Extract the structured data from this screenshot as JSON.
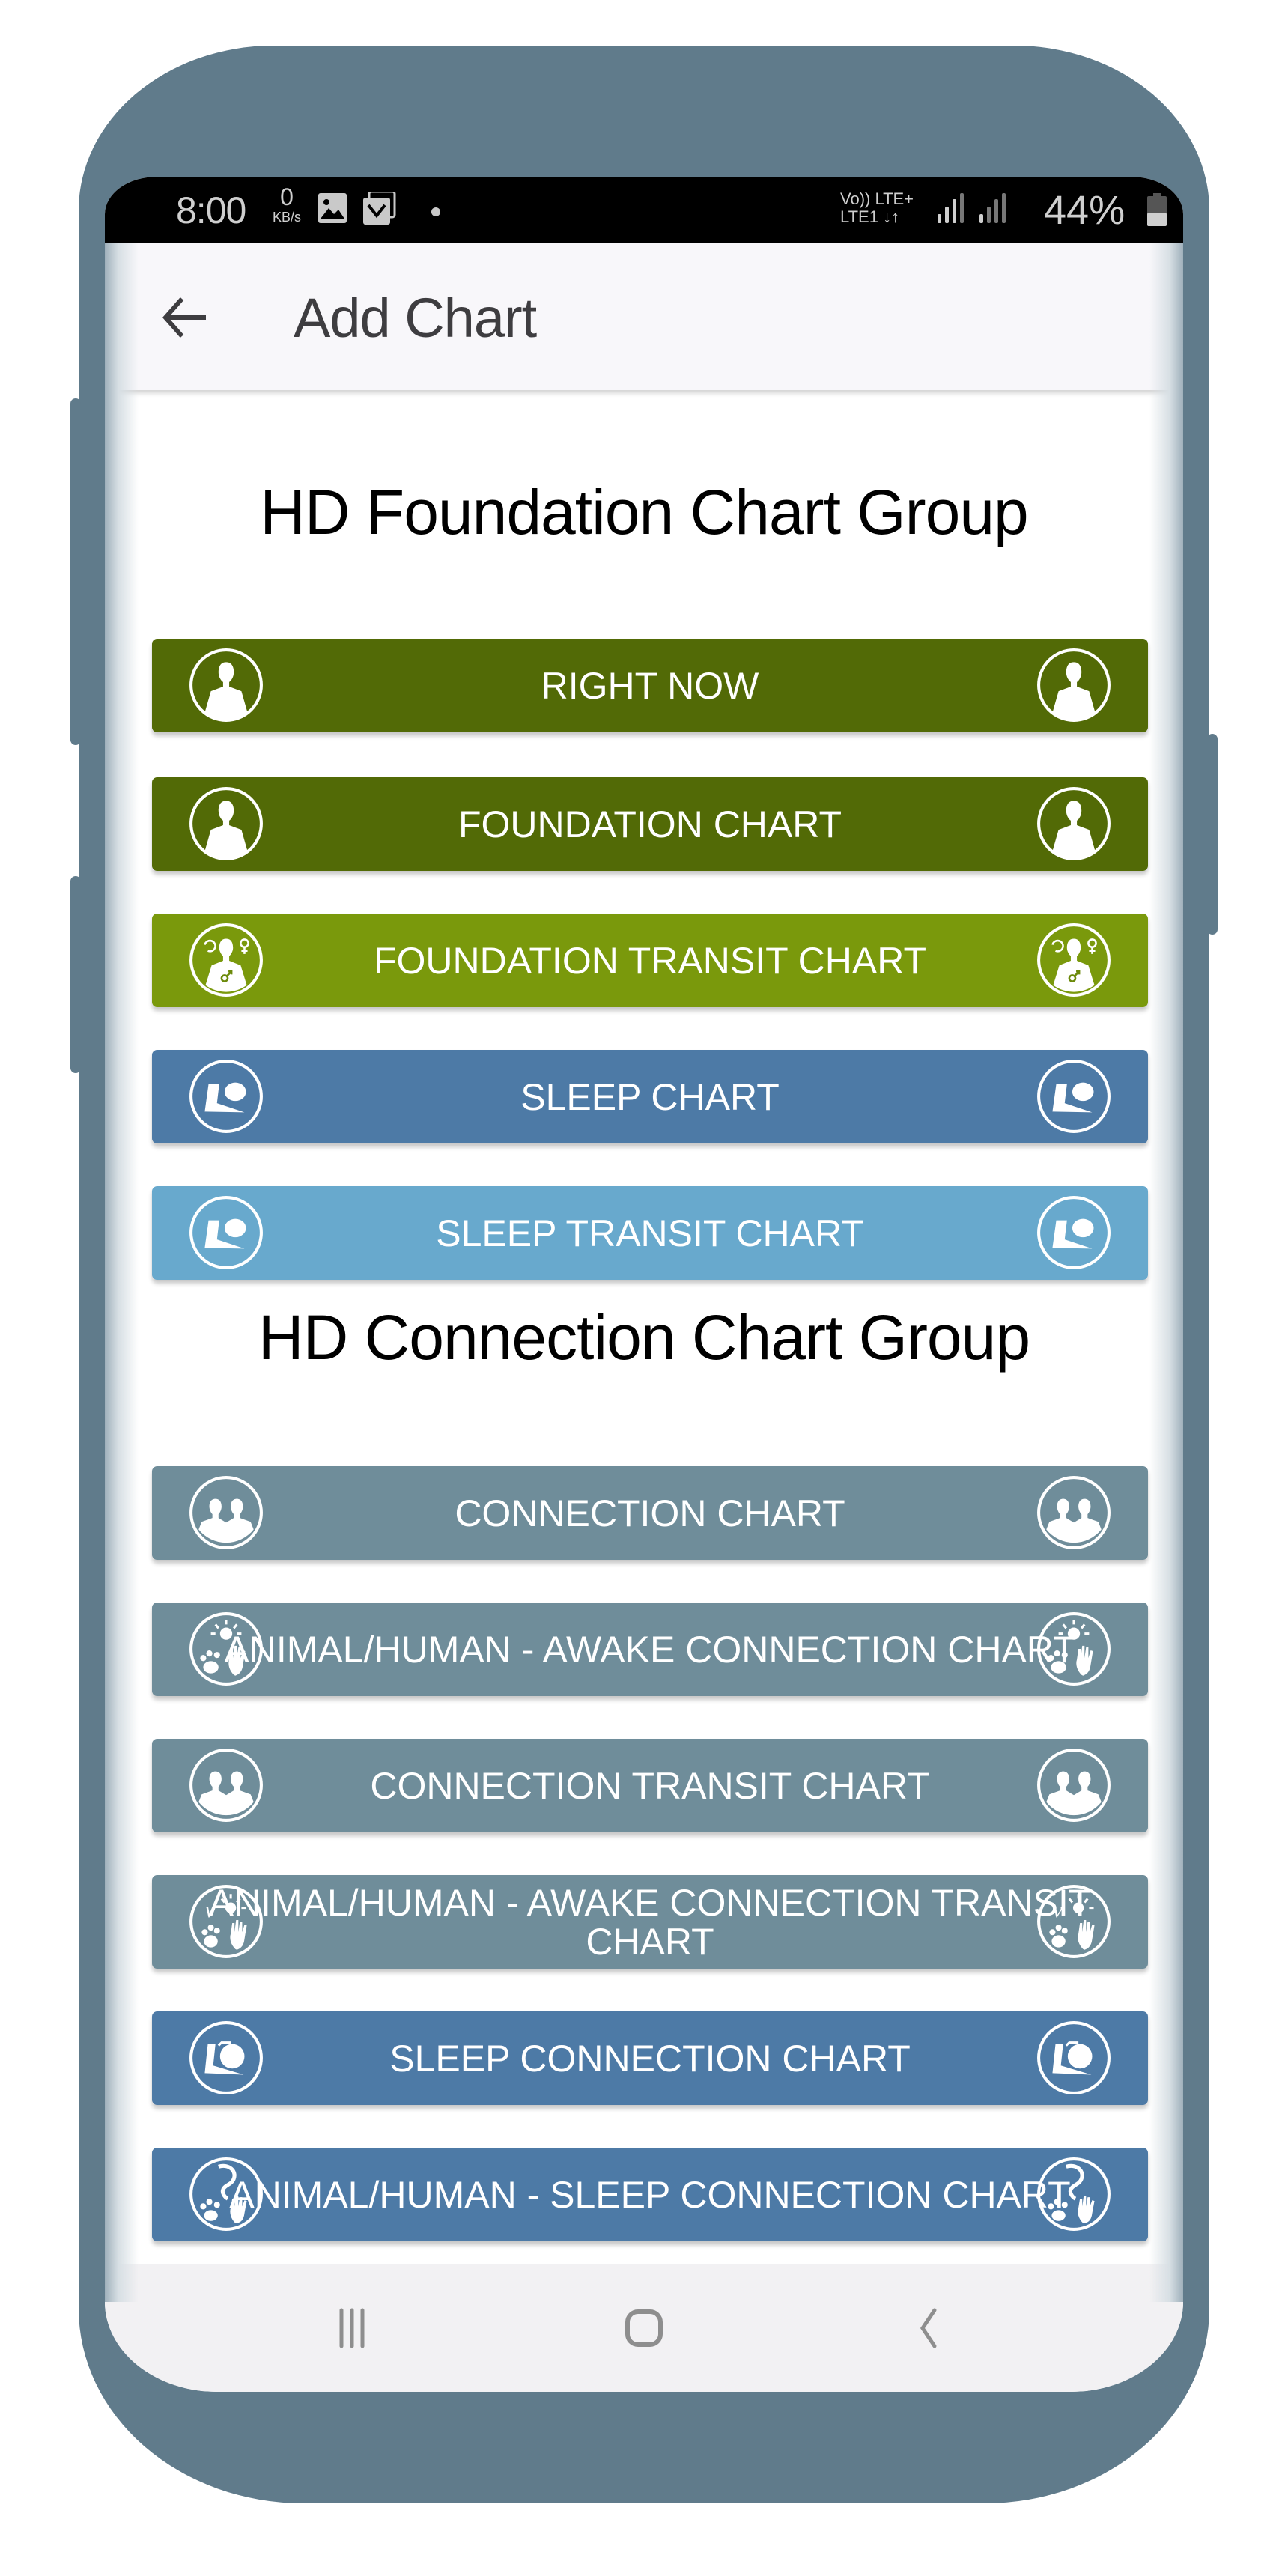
{
  "status_bar": {
    "time": "8:00",
    "net_speed_value": "0",
    "net_speed_unit": "KB/s",
    "notification_icons": [
      "gallery-icon",
      "email-icon",
      "dot-icon"
    ],
    "volte_label": "Vo)) LTE+",
    "lte_label": "LTE1",
    "battery_percent": "44%",
    "battery_level": 0.44
  },
  "app_bar": {
    "back_icon": "arrow-left-icon",
    "title": "Add Chart"
  },
  "groups": [
    {
      "title": "HD Foundation Chart Group",
      "buttons": [
        {
          "label": "RIGHT NOW",
          "icon": "person-icon",
          "color": "#526a06"
        },
        {
          "label": "FOUNDATION CHART",
          "icon": "person-icon",
          "color": "#526a06"
        },
        {
          "label": "FOUNDATION TRANSIT CHART",
          "icon": "person-transit-icon",
          "color": "#7a990c"
        },
        {
          "label": "SLEEP CHART",
          "icon": "sleep-icon",
          "color": "#4d7aa6"
        },
        {
          "label": "SLEEP TRANSIT CHART",
          "icon": "sleep-icon",
          "color": "#68a9cd"
        }
      ]
    },
    {
      "title": "HD Connection Chart Group",
      "buttons": [
        {
          "label": "CONNECTION CHART",
          "icon": "two-people-icon",
          "color": "#6f8d9a"
        },
        {
          "label": "ANIMAL/HUMAN - AWAKE CONNECTION CHART",
          "icon": "paw-hand-icon",
          "color": "#6f8d9a"
        },
        {
          "label": "CONNECTION TRANSIT CHART",
          "icon": "two-people-icon",
          "color": "#6f8d9a"
        },
        {
          "label": "ANIMAL/HUMAN - AWAKE CONNECTION TRANSIT CHART",
          "icon": "paw-hand-transit-icon",
          "color": "#6f8d9a"
        },
        {
          "label": "SLEEP CONNECTION CHART",
          "icon": "sleep-connection-icon",
          "color": "#4d7aa6"
        },
        {
          "label": "ANIMAL/HUMAN - SLEEP CONNECTION CHART",
          "icon": "paw-hand-sleep-icon",
          "color": "#4d7aa6"
        }
      ]
    }
  ],
  "nav_bar": {
    "recents": "recents-icon",
    "home": "home-icon",
    "back": "back-icon"
  },
  "colors": {
    "phone_body": "#607b8b",
    "app_bar_bg": "#f8f7fa",
    "nav_bar_bg": "#f2f1f3"
  }
}
